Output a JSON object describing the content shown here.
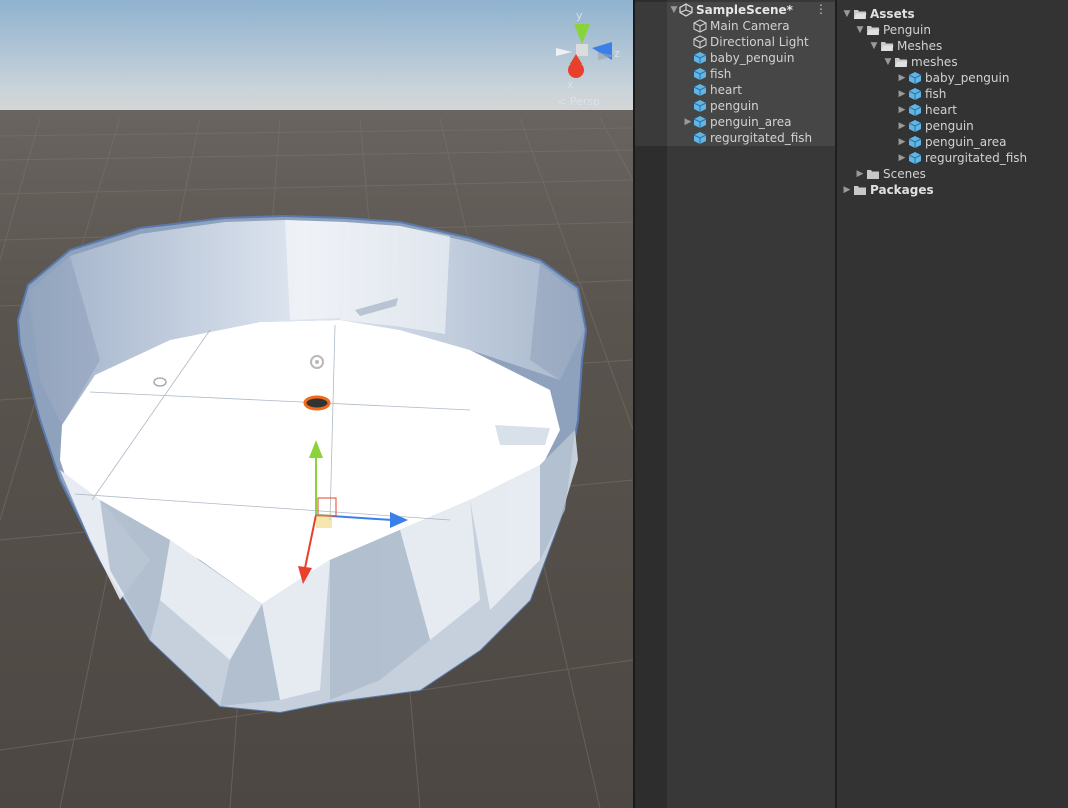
{
  "scene_view": {
    "projection_label": "< Persp",
    "gizmo": {
      "y": "y",
      "x": "x",
      "z": "z"
    }
  },
  "hierarchy": {
    "scene_name": "SampleScene*",
    "items": [
      {
        "label": "Main Camera",
        "icon": "camera-cube-icon",
        "expandable": false
      },
      {
        "label": "Directional Light",
        "icon": "light-cube-icon",
        "expandable": false
      },
      {
        "label": "baby_penguin",
        "icon": "prefab-icon",
        "expandable": false
      },
      {
        "label": "fish",
        "icon": "prefab-icon",
        "expandable": false
      },
      {
        "label": "heart",
        "icon": "prefab-icon",
        "expandable": false
      },
      {
        "label": "penguin",
        "icon": "prefab-icon",
        "expandable": false
      },
      {
        "label": "penguin_area",
        "icon": "prefab-icon",
        "expandable": true
      },
      {
        "label": "regurgitated_fish",
        "icon": "prefab-icon",
        "expandable": false
      }
    ]
  },
  "project": {
    "assets_label": "Assets",
    "penguin_label": "Penguin",
    "meshes_label": "Meshes",
    "meshes_sub_label": "meshes",
    "mesh_items": [
      "baby_penguin",
      "fish",
      "heart",
      "penguin",
      "penguin_area",
      "regurgitated_fish"
    ],
    "scenes_label": "Scenes",
    "packages_label": "Packages"
  },
  "colors": {
    "prefab_blue": "#5fb5e8",
    "gizmo_y": "#8bd33b",
    "gizmo_x": "#e8402a",
    "gizmo_z": "#3b7fe8",
    "folder": "#c8c8c8"
  }
}
